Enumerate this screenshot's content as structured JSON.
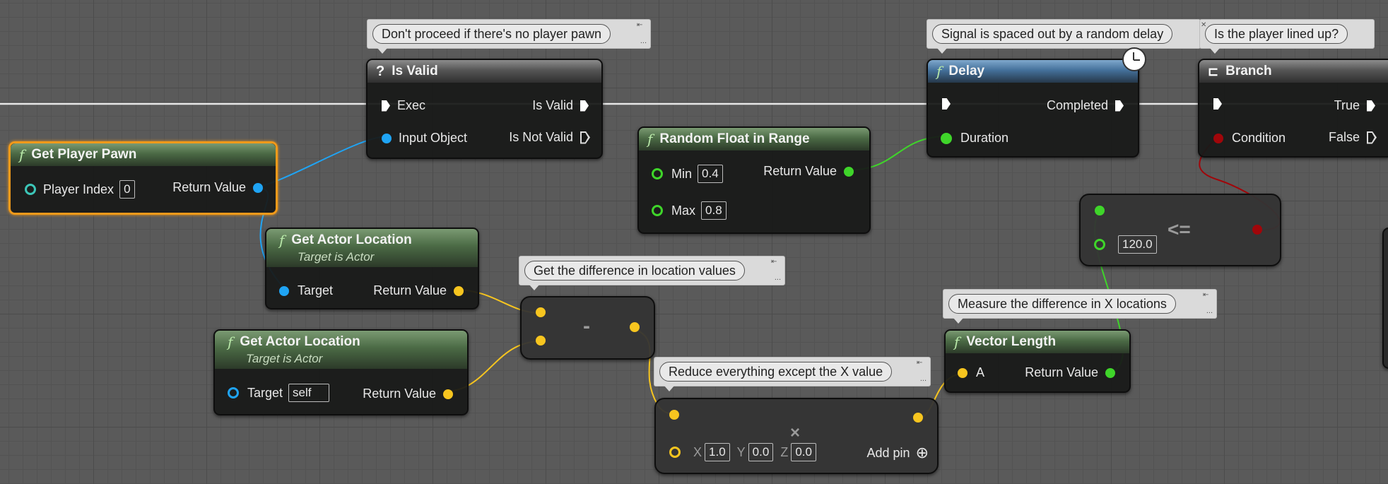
{
  "colors": {
    "object_pin": "#1fa4f4",
    "vector_pin": "#f7c51f",
    "float_pin": "#3fd52a",
    "bool_pin": "#a0060a",
    "selection": "#f29a1a",
    "function_header": "#4b6a45",
    "latent_header": "#44709a"
  },
  "comments": {
    "is_valid": "Don't proceed if there's no player pawn",
    "delay": "Signal is spaced out by a random delay",
    "branch": "Is the player lined up?",
    "subtract": "Get the difference in location values",
    "vector_length": "Measure the difference in X locations",
    "multiply": "Reduce everything except the X value"
  },
  "nodes": {
    "get_player_pawn": {
      "title": "Get Player Pawn",
      "player_index_label": "Player Index",
      "player_index_value": "0",
      "return_label": "Return Value"
    },
    "is_valid": {
      "title": "Is Valid",
      "exec_label": "Exec",
      "input_label": "Input Object",
      "out_valid": "Is Valid",
      "out_not_valid": "Is Not Valid"
    },
    "random_float": {
      "title": "Random Float in Range",
      "min_label": "Min",
      "min_value": "0.4",
      "max_label": "Max",
      "max_value": "0.8",
      "return_label": "Return Value"
    },
    "delay": {
      "title": "Delay",
      "duration_label": "Duration",
      "completed_label": "Completed"
    },
    "branch": {
      "title": "Branch",
      "condition_label": "Condition",
      "true_label": "True",
      "false_label": "False"
    },
    "compare": {
      "value": "120.0",
      "operator": "<="
    },
    "get_actor_location_1": {
      "title": "Get Actor Location",
      "subtitle": "Target is Actor",
      "target_label": "Target",
      "return_label": "Return Value"
    },
    "get_actor_location_2": {
      "title": "Get Actor Location",
      "subtitle": "Target is Actor",
      "target_label": "Target",
      "target_value": "self",
      "return_label": "Return Value"
    },
    "subtract": {
      "operator": "-"
    },
    "vector_length": {
      "title": "Vector Length",
      "a_label": "A",
      "return_label": "Return Value"
    },
    "multiply": {
      "operator": "×",
      "x_label": "X",
      "x_value": "1.0",
      "y_label": "Y",
      "y_value": "0.0",
      "z_label": "Z",
      "z_value": "0.0",
      "add_pin_label": "Add pin",
      "add_pin_icon": "⊕"
    }
  }
}
